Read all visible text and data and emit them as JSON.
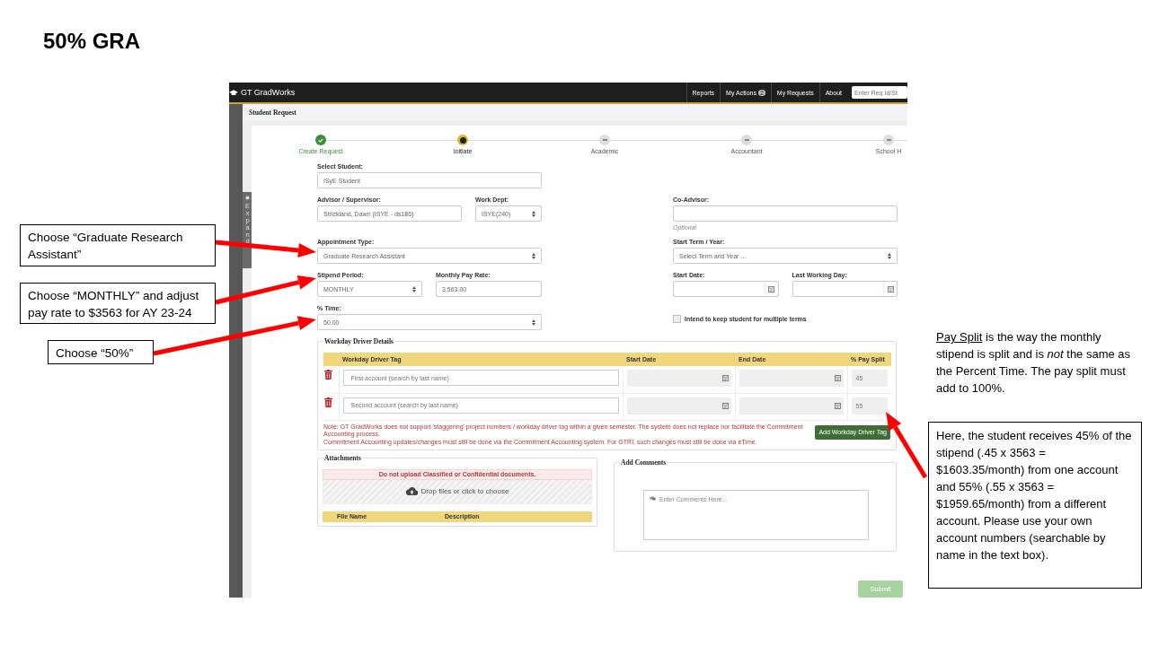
{
  "slide": {
    "title": "50% GRA"
  },
  "callouts": [
    {
      "text": "Choose “Graduate Research Assistant”"
    },
    {
      "text": "Choose “MONTHLY” and adjust pay rate to $3563 for AY 23-24"
    },
    {
      "text": "Choose “50%”"
    }
  ],
  "notes": [
    {
      "term": "Pay Split",
      "text": " is the way the monthly stipend is split and is *not* the same as the Percent Time.  The pay split must add to 100%.",
      "boxed": false
    },
    {
      "text": "Here, the student receives 45% of the stipend (.45 x 3563 = $1603.35/month)  from one account and 55% (.55 x 3563 = $1959.65/month)  from a different account. Please use your own account numbers (searchable by name in the text box).",
      "boxed": true
    }
  ],
  "app": {
    "brand": "GT GradWorks",
    "nav": [
      {
        "label": "Reports"
      },
      {
        "label": "My Actions",
        "badge": "2"
      },
      {
        "label": "My Requests"
      },
      {
        "label": "About"
      }
    ],
    "search": {
      "placeholder": "Enter Req Id/St"
    },
    "page_title": "Student Request",
    "sidebar_toggle": "Expand",
    "steps": [
      {
        "label": "Create Request",
        "completed": true,
        "current": false
      },
      {
        "label": "Initiate",
        "completed": false,
        "current": true
      },
      {
        "label": "Academic",
        "completed": false,
        "current": false
      },
      {
        "label": "Accountant",
        "completed": false,
        "current": false
      },
      {
        "label": "School H",
        "completed": false,
        "current": false
      }
    ],
    "form_rows": [
      {
        "left": [
          {
            "kind": "text",
            "label": "Select Student:",
            "value": "ISyE Student"
          }
        ],
        "right": []
      },
      {
        "left": [
          {
            "kind": "text",
            "label": "Advisor / Supervisor:",
            "value": "Strickland,  Dawn (ISYE - ds186)"
          },
          {
            "kind": "select",
            "label": "Work Dept:",
            "value": "ISYE(240)"
          }
        ],
        "right": [
          {
            "kind": "text",
            "label": "Co-Advisor:",
            "hint": "Optional"
          }
        ]
      },
      {
        "left": [
          {
            "kind": "select",
            "label": "Appointment Type:",
            "value": "Graduate Research Assistant"
          }
        ],
        "right": [
          {
            "kind": "select",
            "label": "Start Term / Year:",
            "placeholder": "Select Term and Year ..."
          }
        ]
      },
      {
        "left": [
          {
            "kind": "select",
            "label": "Stipend Period:",
            "value": "MONTHLY"
          },
          {
            "kind": "text",
            "label": "Monthly Pay Rate:",
            "value": "3,563.00"
          }
        ],
        "right": [
          {
            "kind": "date",
            "label": "Start Date:"
          },
          {
            "kind": "date",
            "label": "Last Working Day:"
          }
        ]
      },
      {
        "left": [
          {
            "kind": "select",
            "label": "% Time:",
            "value": "50.00"
          }
        ],
        "right": [
          {
            "kind": "checkbox",
            "label": "Intend to keep student for multiple terms",
            "checked": false
          }
        ]
      }
    ],
    "workday": {
      "title": "Workday Driver Details",
      "columns": [
        "Workday Driver Tag",
        "Start Date",
        "End Date",
        "% Pay Split"
      ],
      "rows": [
        {
          "placeholder": "First account (search by last name)",
          "pay_split": "45",
          "disabled": true
        },
        {
          "placeholder": "Second account (search by last name)",
          "pay_split": "55",
          "disabled": true
        }
      ],
      "notes": [
        "Note: GT GradWorks does not support 'staggering' project numbers / workday driver tag within a given semester. The system does not replace nor facilitate the Commitment Accounting process.",
        "Commitment Accounting updates/changes must still be done via the Commitment Accounting system. For GTRI, such changes must still be done via eTime."
      ],
      "add_button": "Add Workday Driver Tag"
    },
    "attachments": {
      "title": "Attachments",
      "warning": "Do not upload Classified or Confidential documents.",
      "drop": "Drop files or click to choose",
      "columns": [
        "File Name",
        "Description"
      ]
    },
    "comments": {
      "title": "Add Comments",
      "placeholder": "Enter Comments Here..."
    },
    "submit": {
      "label": "Submit",
      "disabled": true
    }
  }
}
